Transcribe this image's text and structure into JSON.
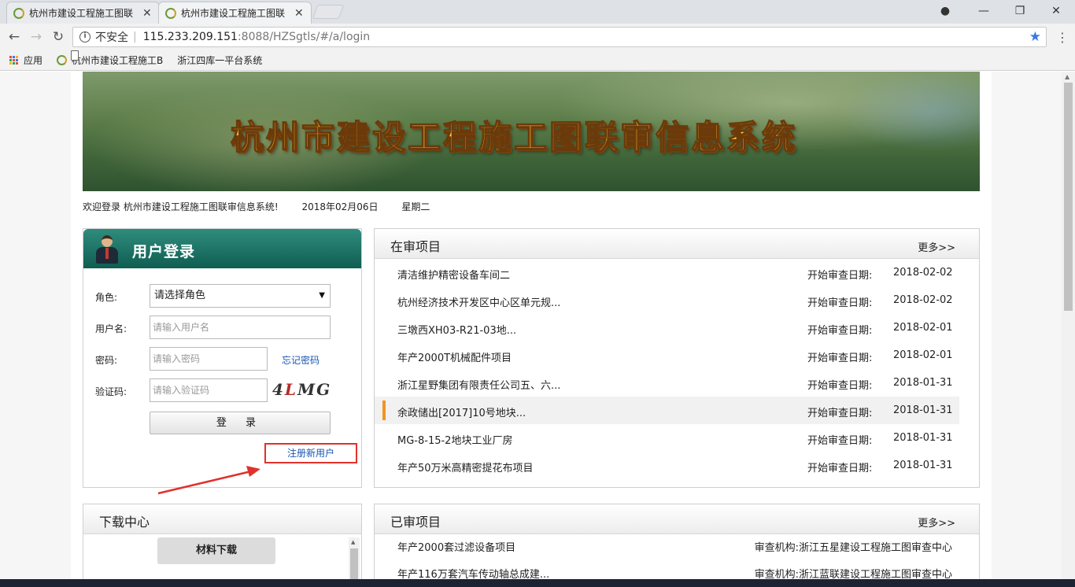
{
  "browser": {
    "tabs": [
      {
        "title": "杭州市建设工程施工图联",
        "close": "✕"
      },
      {
        "title": "杭州市建设工程施工图联",
        "close": "✕"
      }
    ],
    "window_controls": {
      "account": "●",
      "minimize": "—",
      "maximize": "❐",
      "close": "✕"
    },
    "nav": {
      "back": "←",
      "forward": "→",
      "reload": "↻"
    },
    "address": {
      "info": "i",
      "security_label": "不安全",
      "separator": "|",
      "host": "115.233.209.151",
      "path": ":8088/HZSgtls/#/a/login",
      "star": "★"
    },
    "menu": "⋮",
    "bookmarks": [
      {
        "label": "应用",
        "icon": "apps-icon"
      },
      {
        "label": "杭州市建设工程施工B",
        "icon": "site-favicon"
      },
      {
        "label": "浙江四库一平台系统",
        "icon": "page-icon"
      }
    ]
  },
  "page": {
    "banner_title": "杭州市建设工程施工图联审信息系统",
    "welcome": {
      "text": "欢迎登录 杭州市建设工程施工图联审信息系统!",
      "date": "2018年02月06日",
      "weekday": "星期二"
    },
    "login": {
      "title": "用户登录",
      "role_label": "角色:",
      "role_value": "请选择角色",
      "username_label": "用户名:",
      "username_placeholder": "请输入用户名",
      "password_label": "密码:",
      "password_placeholder": "请输入密码",
      "forgot": "忘记密码",
      "captcha_label": "验证码:",
      "captcha_placeholder": "请输入验证码",
      "captcha_text": "4LMG",
      "submit": "登 录",
      "register": "注册新用户"
    },
    "in_review": {
      "title": "在审项目",
      "more": "更多>>",
      "date_label": "开始审查日期:",
      "items": [
        {
          "name": "清洁维护精密设备车间二",
          "date": "2018-02-02"
        },
        {
          "name": "杭州经济技术开发区中心区单元规...",
          "date": "2018-02-02"
        },
        {
          "name": "三墩西XH03-R21-03地...",
          "date": "2018-02-01"
        },
        {
          "name": "年产2000T机械配件项目",
          "date": "2018-02-01"
        },
        {
          "name": "浙江星野集团有限责任公司五、六...",
          "date": "2018-01-31"
        },
        {
          "name": "余政储出[2017]10号地块...",
          "date": "2018-01-31"
        },
        {
          "name": "MG-8-15-2地块工业厂房",
          "date": "2018-01-31"
        },
        {
          "name": "年产50万米高精密提花布项目",
          "date": "2018-01-31"
        }
      ],
      "active_index": 5
    },
    "download": {
      "title": "下载中心",
      "button": "材料下载"
    },
    "reviewed": {
      "title": "已审项目",
      "more": "更多>>",
      "items": [
        {
          "name": "年产2000套过滤设备项目",
          "org": "审查机构:浙江五星建设工程施工图审查中心"
        },
        {
          "name": "年产116万套汽车传动轴总成建...",
          "org": "审查机构:浙江蓝联建设工程施工图审查中心"
        }
      ]
    }
  },
  "colors": {
    "login_header": "#0f5e52",
    "link": "#1a56b0",
    "highlight_box": "#e0322c",
    "active_marker": "#f2941c",
    "banner_title": "#ffd23c"
  }
}
